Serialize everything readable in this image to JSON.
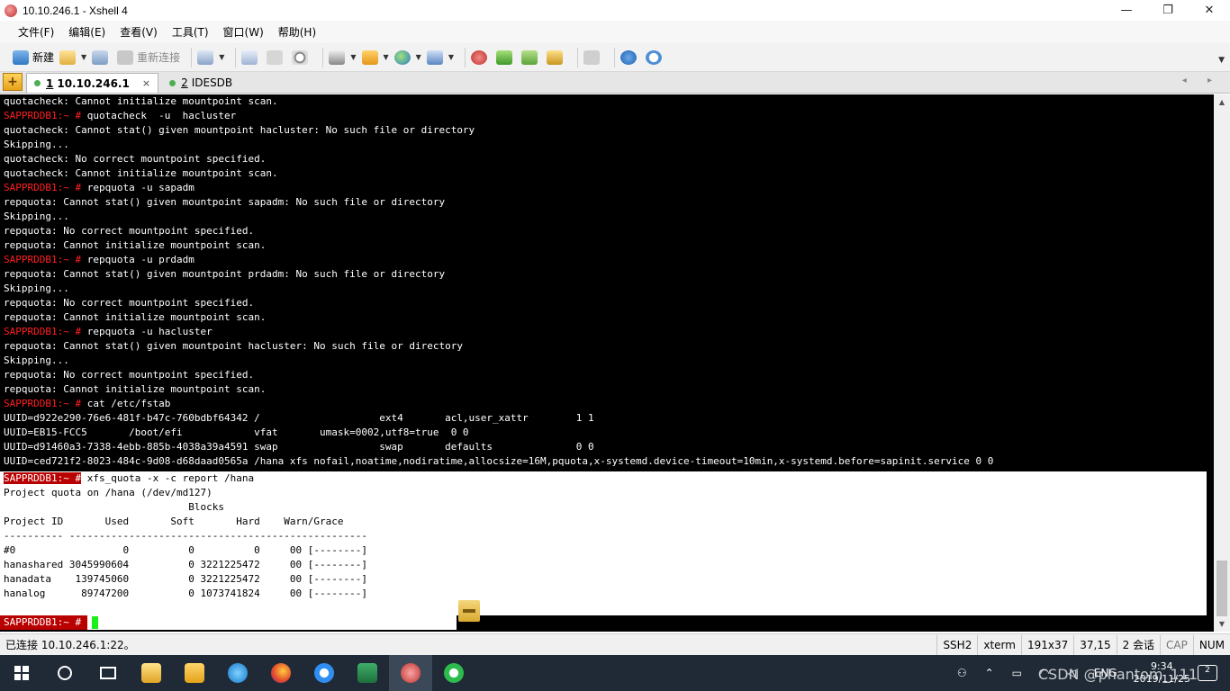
{
  "window": {
    "title": "10.10.246.1 - Xshell 4",
    "minimize": "—",
    "maximize": "❐",
    "close": "✕"
  },
  "menu": [
    "文件(F)",
    "编辑(E)",
    "查看(V)",
    "工具(T)",
    "窗口(W)",
    "帮助(H)"
  ],
  "toolbar": {
    "new_label": "新建",
    "reconnect_label": "重新连接"
  },
  "tabs": [
    {
      "num": "1",
      "label": "10.10.246.1",
      "active": true,
      "close": "×"
    },
    {
      "num": "2",
      "label": "IDESDB",
      "active": false
    }
  ],
  "tab_nav": "◂ ▸",
  "terminal": {
    "prompt": "SAPPRDDB1:~ #",
    "lines": [
      {
        "prompt": "",
        "text": "quotacheck: Cannot initialize mountpoint scan."
      },
      {
        "prompt": "SAPPRDDB1:~ #",
        "text": " quotacheck  -u  hacluster"
      },
      {
        "prompt": "",
        "text": "quotacheck: Cannot stat() given mountpoint hacluster: No such file or directory"
      },
      {
        "prompt": "",
        "text": "Skipping..."
      },
      {
        "prompt": "",
        "text": "quotacheck: No correct mountpoint specified."
      },
      {
        "prompt": "",
        "text": "quotacheck: Cannot initialize mountpoint scan."
      },
      {
        "prompt": "SAPPRDDB1:~ #",
        "text": " repquota -u sapadm"
      },
      {
        "prompt": "",
        "text": "repquota: Cannot stat() given mountpoint sapadm: No such file or directory"
      },
      {
        "prompt": "",
        "text": "Skipping..."
      },
      {
        "prompt": "",
        "text": "repquota: No correct mountpoint specified."
      },
      {
        "prompt": "",
        "text": "repquota: Cannot initialize mountpoint scan."
      },
      {
        "prompt": "SAPPRDDB1:~ #",
        "text": " repquota -u prdadm"
      },
      {
        "prompt": "",
        "text": "repquota: Cannot stat() given mountpoint prdadm: No such file or directory"
      },
      {
        "prompt": "",
        "text": "Skipping..."
      },
      {
        "prompt": "",
        "text": "repquota: No correct mountpoint specified."
      },
      {
        "prompt": "",
        "text": "repquota: Cannot initialize mountpoint scan."
      },
      {
        "prompt": "SAPPRDDB1:~ #",
        "text": " repquota -u hacluster"
      },
      {
        "prompt": "",
        "text": "repquota: Cannot stat() given mountpoint hacluster: No such file or directory"
      },
      {
        "prompt": "",
        "text": "Skipping..."
      },
      {
        "prompt": "",
        "text": "repquota: No correct mountpoint specified."
      },
      {
        "prompt": "",
        "text": "repquota: Cannot initialize mountpoint scan."
      },
      {
        "prompt": "SAPPRDDB1:~ #",
        "text": " cat /etc/fstab"
      },
      {
        "prompt": "",
        "text": "UUID=d922e290-76e6-481f-b47c-760bdbf64342 /                    ext4       acl,user_xattr        1 1"
      },
      {
        "prompt": "",
        "text": "UUID=EB15-FCC5       /boot/efi            vfat       umask=0002,utf8=true  0 0"
      },
      {
        "prompt": "",
        "text": "UUID=d91460a3-7338-4ebb-885b-4038a39a4591 swap                 swap       defaults              0 0"
      },
      {
        "prompt": "",
        "text": "UUID=ced721f2-8023-484c-9d08-d68daad0565a /hana xfs nofail,noatime,nodiratime,allocsize=16M,pquota,x-systemd.device-timeout=10min,x-systemd.before=sapinit.service 0 0"
      }
    ],
    "selected_lines": [
      {
        "prompt": "SAPPRDDB1:~ #",
        "text": " xfs_quota -x -c report /hana"
      },
      {
        "prompt": "",
        "text": "Project quota on /hana (/dev/md127)"
      },
      {
        "prompt": "",
        "text": "                               Blocks"
      },
      {
        "prompt": "",
        "text": "Project ID       Used       Soft       Hard    Warn/Grace"
      },
      {
        "prompt": "",
        "text": "---------- --------------------------------------------------"
      },
      {
        "prompt": "",
        "text": "#0                  0          0          0     00 [--------]"
      },
      {
        "prompt": "",
        "text": "hanashared 3045990604          0 3221225472     00 [--------]"
      },
      {
        "prompt": "",
        "text": "hanadata    139745060          0 3221225472     00 [--------]"
      },
      {
        "prompt": "",
        "text": "hanalog      89747200          0 1073741824     00 [--------]"
      },
      {
        "prompt": "",
        "text": ""
      }
    ],
    "last_prompt": "SAPPRDDB1:~ # "
  },
  "status": {
    "connection": "已连接 10.10.246.1:22。",
    "protocol": "SSH2",
    "terminal_type": "xterm",
    "size": "191x37",
    "cursor_pos": "37,15",
    "sessions": "2 会话",
    "cap": "CAP",
    "num": "NUM"
  },
  "taskbar": {
    "tray_lang": "ENG",
    "time": "9:34",
    "date": "2019/11/25",
    "notification_count": "2"
  },
  "watermark": "CSDN @phantom_111",
  "colors": {
    "prompt_red": "#ff2020",
    "cursor_green": "#18f018",
    "taskbar_bg": "#1f2a36"
  }
}
